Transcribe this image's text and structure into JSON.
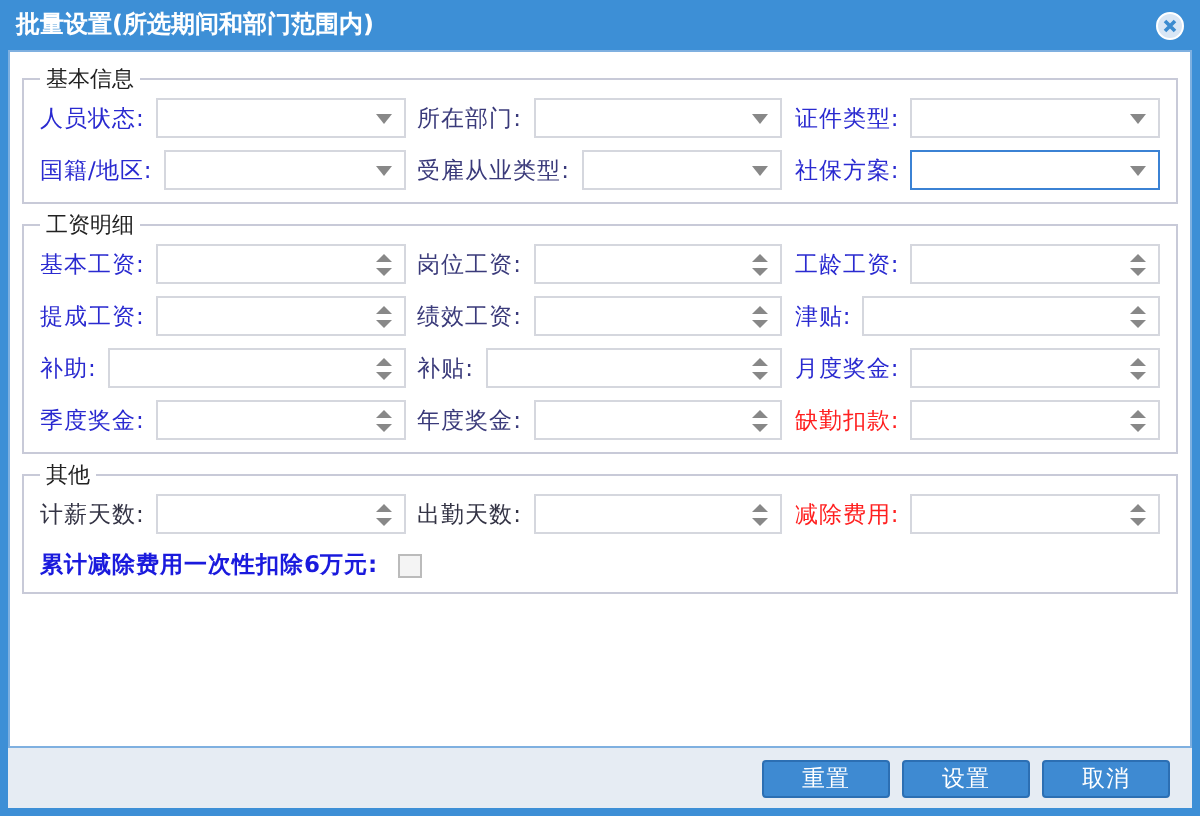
{
  "window": {
    "title": "批量设置(所选期间和部门范围内)"
  },
  "sections": [
    {
      "legend": "基本信息",
      "fields": [
        {
          "label": "人员状态:",
          "color": "#2a2ad0",
          "kind": "select",
          "focused": false
        },
        {
          "label": "所在部门:",
          "color": "#3a3a7a",
          "kind": "select",
          "focused": false
        },
        {
          "label": "证件类型:",
          "color": "#2a2ad0",
          "kind": "select",
          "focused": false
        },
        {
          "label": "国籍/地区:",
          "color": "#2a2ad0",
          "kind": "select",
          "focused": false
        },
        {
          "label": "受雇从业类型:",
          "color": "#3a3a7a",
          "kind": "select",
          "focused": false
        },
        {
          "label": "社保方案:",
          "color": "#2a2ad0",
          "kind": "select",
          "focused": true
        }
      ]
    },
    {
      "legend": "工资明细",
      "fields": [
        {
          "label": "基本工资:",
          "color": "#2a2ad0",
          "kind": "spinner",
          "focused": false
        },
        {
          "label": "岗位工资:",
          "color": "#3a3a7a",
          "kind": "spinner",
          "focused": false
        },
        {
          "label": "工龄工资:",
          "color": "#2a2ad0",
          "kind": "spinner",
          "focused": false
        },
        {
          "label": "提成工资:",
          "color": "#2a2ad0",
          "kind": "spinner",
          "focused": false
        },
        {
          "label": "绩效工资:",
          "color": "#3a3a7a",
          "kind": "spinner",
          "focused": false
        },
        {
          "label": "津贴:",
          "color": "#2a2ad0",
          "kind": "spinner",
          "focused": false
        },
        {
          "label": "补助:",
          "color": "#2a2ad0",
          "kind": "spinner",
          "focused": false
        },
        {
          "label": "补贴:",
          "color": "#3a3a7a",
          "kind": "spinner",
          "focused": false
        },
        {
          "label": "月度奖金:",
          "color": "#2a2ad0",
          "kind": "spinner",
          "focused": false
        },
        {
          "label": "季度奖金:",
          "color": "#2a2ad0",
          "kind": "spinner",
          "focused": false
        },
        {
          "label": "年度奖金:",
          "color": "#3a3a7a",
          "kind": "spinner",
          "focused": false
        },
        {
          "label": "缺勤扣款:",
          "color": "#ff2020",
          "kind": "spinner",
          "focused": false
        }
      ]
    },
    {
      "legend": "其他",
      "fields": [
        {
          "label": "计薪天数:",
          "color": "#333344",
          "kind": "spinner",
          "focused": false
        },
        {
          "label": "出勤天数:",
          "color": "#333344",
          "kind": "spinner",
          "focused": false
        },
        {
          "label": "减除费用:",
          "color": "#ff2020",
          "kind": "spinner",
          "focused": false
        }
      ],
      "checkbox": {
        "label": "累计减除费用一次性扣除6万元:",
        "checked": false
      }
    }
  ],
  "buttons": [
    "重置",
    "设置",
    "取消"
  ]
}
